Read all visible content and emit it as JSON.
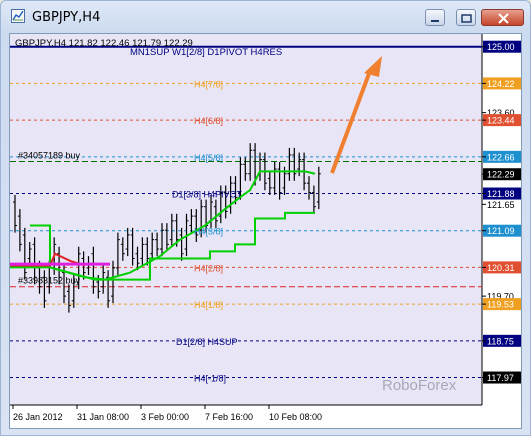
{
  "window": {
    "title": "GBPJPY,H4"
  },
  "chart_header": "GBPJPY,H4  121.82 122.46 121.79 122.29",
  "top_text": "MN1SUP W1[2/8] D1PIVOT H4RES",
  "watermark": "RoboForex",
  "colors": {
    "chart_bg": "#e8e6f6",
    "navy": "#000080",
    "orange": "#f0a020",
    "red": "#e05030",
    "blue": "#1e90d0",
    "green": "#00d000",
    "arrow": "#f08030",
    "magenta": "#e020e0"
  },
  "price_axis": {
    "ticks": [
      {
        "label": "125.00",
        "value": 125.0,
        "badge": "#000080",
        "text": "#ffffff"
      },
      {
        "label": "124.22",
        "value": 124.22,
        "badge": "#f0a020",
        "text": "#ffffff"
      },
      {
        "label": "123.60",
        "value": 123.6,
        "badge": "",
        "text": "#000000"
      },
      {
        "label": "123.44",
        "value": 123.44,
        "badge": "#e05030",
        "text": "#ffffff"
      },
      {
        "label": "122.66",
        "value": 122.66,
        "badge": "#1e90d0",
        "text": "#ffffff"
      },
      {
        "label": "122.29",
        "value": 122.29,
        "badge": "#000000",
        "text": "#ffffff"
      },
      {
        "label": "121.88",
        "value": 121.88,
        "badge": "#000080",
        "text": "#ffffff"
      },
      {
        "label": "121.65",
        "value": 121.65,
        "badge": "",
        "text": "#000000"
      },
      {
        "label": "121.09",
        "value": 121.09,
        "badge": "#1e90d0",
        "text": "#ffffff"
      },
      {
        "label": "120.31",
        "value": 120.31,
        "badge": "#e05030",
        "text": "#ffffff"
      },
      {
        "label": "119.70",
        "value": 119.7,
        "badge": "",
        "text": "#000000"
      },
      {
        "label": "119.53",
        "value": 119.53,
        "badge": "#f0a020",
        "text": "#ffffff"
      },
      {
        "label": "118.75",
        "value": 118.75,
        "badge": "#000080",
        "text": "#ffffff"
      },
      {
        "label": "117.97",
        "value": 117.97,
        "badge": "#000000",
        "text": "#ffffff"
      }
    ]
  },
  "time_axis": {
    "labels": [
      "26 Jan 2012",
      "31 Jan 08:00",
      "3 Feb 00:00",
      "7 Feb 16:00",
      "10 Feb 08:00"
    ]
  },
  "levels": [
    {
      "name": "level-125-00",
      "value": 125.0,
      "color": "#000080",
      "style": "solid",
      "label": "MN1SUP W1[2/8] D1PIVOT H4RES"
    },
    {
      "name": "level-h4-7-8",
      "value": 124.22,
      "color": "#f0a020",
      "style": "dash",
      "label": "H4[7/8]"
    },
    {
      "name": "level-h4-6-8",
      "value": 123.44,
      "color": "#e05030",
      "style": "dash",
      "label": "H4[6/8]"
    },
    {
      "name": "level-h4-5-8",
      "value": 122.66,
      "color": "#1e90d0",
      "style": "dash",
      "label": "H4[5/8]"
    },
    {
      "name": "level-d1-3-8",
      "value": 121.88,
      "color": "#000080",
      "style": "dash",
      "label": "D1[3/8] H4PIVOT"
    },
    {
      "name": "level-h4-3-8",
      "value": 121.09,
      "color": "#1e90d0",
      "style": "dash",
      "label": "H4[3/8]"
    },
    {
      "name": "level-h4-2-8",
      "value": 120.31,
      "color": "#e05030",
      "style": "dash",
      "label": "H4[2/8]"
    },
    {
      "name": "level-h4-1-8",
      "value": 119.53,
      "color": "#f0a020",
      "style": "dash",
      "label": "H4[1/8]"
    },
    {
      "name": "level-d1-2-8",
      "value": 118.75,
      "color": "#000080",
      "style": "dash",
      "label": "D1[2/8] H4SUP"
    },
    {
      "name": "level-h4-m1-8",
      "value": 117.97,
      "color": "#000080",
      "style": "dash",
      "label": "H4[-1/8]"
    }
  ],
  "orders": [
    {
      "name": "order-buy-34057189",
      "value": 122.56,
      "color": "#007000",
      "label": "#34057189 buy"
    },
    {
      "name": "order-buy-33983",
      "value": 119.9,
      "color": "#e02020",
      "label": "#33983152 buy"
    }
  ],
  "chart_data": {
    "type": "candlestick",
    "symbol": "GBPJPY",
    "timeframe": "H4",
    "ylim": [
      117.62,
      125.1
    ],
    "ohlc": {
      "open": 121.82,
      "high": 122.46,
      "low": 121.79,
      "close": 122.29
    },
    "candles": [
      [
        121.7,
        121.2
      ],
      [
        121.4,
        120.8
      ],
      [
        121.0,
        120.2
      ],
      [
        120.5,
        120.7
      ],
      [
        120.8,
        120.1
      ],
      [
        120.3,
        119.9
      ],
      [
        120.1,
        119.6
      ],
      [
        119.9,
        120.3
      ],
      [
        120.3,
        120.8
      ],
      [
        120.6,
        120.1
      ],
      [
        120.2,
        119.7
      ],
      [
        119.8,
        119.5
      ],
      [
        119.6,
        120.0
      ],
      [
        120.0,
        120.6
      ],
      [
        120.5,
        120.2
      ],
      [
        120.3,
        120.4
      ],
      [
        120.6,
        119.9
      ],
      [
        120.0,
        119.8
      ],
      [
        119.9,
        120.2
      ],
      [
        120.1,
        119.6
      ],
      [
        119.7,
        120.3
      ],
      [
        120.3,
        120.9
      ],
      [
        120.8,
        120.6
      ],
      [
        120.7,
        121.0
      ],
      [
        121.0,
        120.5
      ],
      [
        120.6,
        120.4
      ],
      [
        120.5,
        120.8
      ],
      [
        120.8,
        120.5
      ],
      [
        120.6,
        120.9
      ],
      [
        120.9,
        120.7
      ],
      [
        120.7,
        121.1
      ],
      [
        121.1,
        120.8
      ],
      [
        120.9,
        121.3
      ],
      [
        121.3,
        120.9
      ],
      [
        121.0,
        120.6
      ],
      [
        120.7,
        121.3
      ],
      [
        121.2,
        121.4
      ],
      [
        121.4,
        121.0
      ],
      [
        121.1,
        121.6
      ],
      [
        121.6,
        121.2
      ],
      [
        121.3,
        121.7
      ],
      [
        121.6,
        121.3
      ],
      [
        121.4,
        121.9
      ],
      [
        121.9,
        121.5
      ],
      [
        121.6,
        122.1
      ],
      [
        122.1,
        121.8
      ],
      [
        121.9,
        122.5
      ],
      [
        122.5,
        122.3
      ],
      [
        122.3,
        122.8
      ],
      [
        122.8,
        122.2
      ],
      [
        122.3,
        122.6
      ],
      [
        122.6,
        122.1
      ],
      [
        122.2,
        122.0
      ],
      [
        122.0,
        122.4
      ],
      [
        122.4,
        121.9
      ],
      [
        122.0,
        122.3
      ],
      [
        122.3,
        122.7
      ],
      [
        122.7,
        122.3
      ],
      [
        122.4,
        122.6
      ],
      [
        122.6,
        122.1
      ],
      [
        122.1,
        121.9
      ],
      [
        121.9,
        121.6
      ],
      [
        121.7,
        122.3
      ]
    ],
    "series": [
      {
        "name": "jaw",
        "color": "#00d000",
        "values": []
      },
      {
        "name": "trend",
        "color": "#00d000",
        "values": []
      }
    ]
  }
}
